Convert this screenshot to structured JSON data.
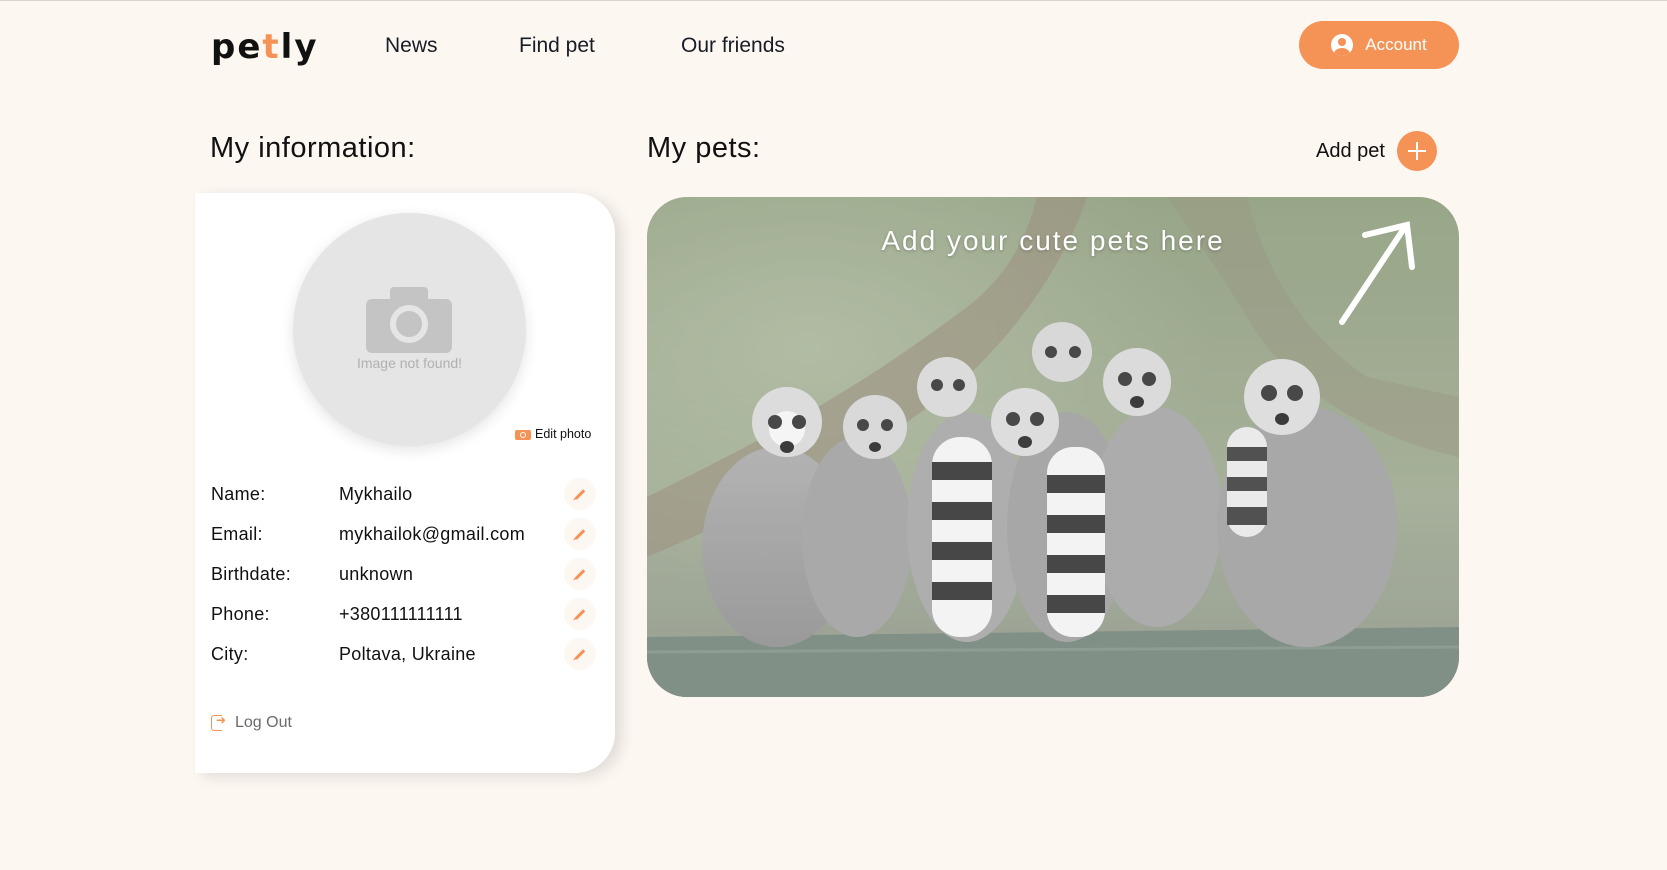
{
  "header": {
    "logo": {
      "part1": "pe",
      "accent": "t",
      "part2": "ly"
    },
    "nav": [
      "News",
      "Find pet",
      "Our friends"
    ],
    "account_label": "Account"
  },
  "profile": {
    "title": "My information:",
    "avatar_placeholder": "Image not found!",
    "edit_photo_label": "Edit photo",
    "fields": [
      {
        "label": "Name:",
        "value": "Mykhailo"
      },
      {
        "label": "Email:",
        "value": "mykhailok@gmail.com"
      },
      {
        "label": "Birthdate:",
        "value": "unknown"
      },
      {
        "label": "Phone:",
        "value": "+380111111111"
      },
      {
        "label": "City:",
        "value": "Poltava, Ukraine"
      }
    ],
    "logout_label": "Log Out"
  },
  "pets": {
    "title": "My pets:",
    "add_pet_label": "Add pet",
    "empty_banner_text": "Add your cute pets here"
  },
  "colors": {
    "accent": "#f59256",
    "background": "#fdf7f2",
    "card": "#ffffff"
  },
  "icons": [
    "account-icon",
    "camera-icon",
    "edit-pencil-icon",
    "logout-icon",
    "plus-icon",
    "arrow-up-right-icon"
  ]
}
